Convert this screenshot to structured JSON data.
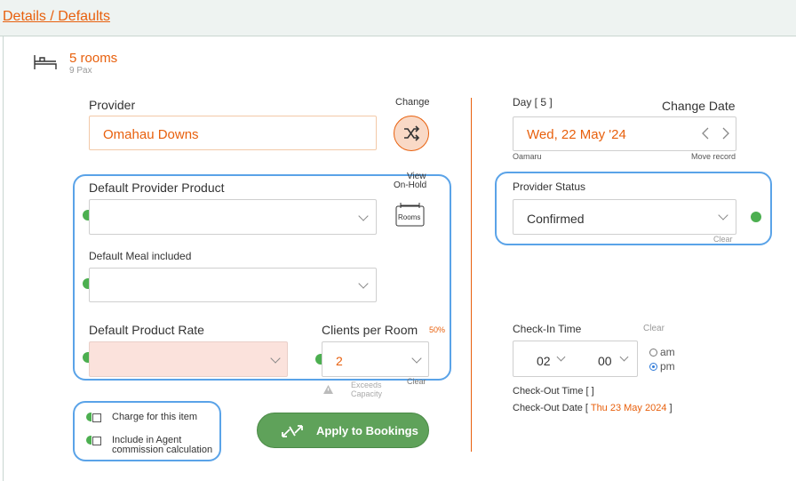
{
  "header": {
    "title": "Details / Defaults"
  },
  "summary": {
    "rooms": "5 rooms",
    "pax": "9 Pax",
    "icon": "bed-icon"
  },
  "provider": {
    "label": "Provider",
    "value": "Omahau Downs",
    "change_label": "Change",
    "change_icon": "shuffle-icon"
  },
  "product": {
    "label": "Default Provider Product",
    "view_label_1": "View",
    "view_label_2": "On-Hold",
    "rooms_label": "Rooms",
    "meal_label": "Default Meal included",
    "rate_label": "Default Product Rate",
    "clients_label": "Clients per Room",
    "clients_pct": "50%",
    "clients_value": "2",
    "clear_label": "Clear",
    "exceeds_1": "Exceeds",
    "exceeds_2": "Capacity"
  },
  "options": {
    "charge_label": "Charge for this item",
    "commission_label_1": "Include in Agent",
    "commission_label_2": "commission calculation"
  },
  "apply": {
    "label": "Apply to Bookings",
    "icon": "arrows-icon"
  },
  "day": {
    "label": "Day [ 5 ]",
    "change_date_label": "Change Date",
    "date_value": "Wed, 22 May '24",
    "location": "Oamaru",
    "move_record": "Move record"
  },
  "status": {
    "label": "Provider Status",
    "value": "Confirmed",
    "clear_label": "Clear"
  },
  "checkin": {
    "label": "Check-In Time",
    "clear_label": "Clear",
    "hour": "02",
    "minute": "00",
    "am_label": "am",
    "pm_label": "pm",
    "checkout_time_label": "Check-Out Time [ ]",
    "checkout_date_prefix": "Check-Out Date [",
    "checkout_date_value": "Thu 23 May 2024",
    "checkout_date_suffix": "]"
  },
  "colors": {
    "accent": "#e8600d",
    "highlight": "#5aa3e8",
    "success": "#4caf50"
  }
}
